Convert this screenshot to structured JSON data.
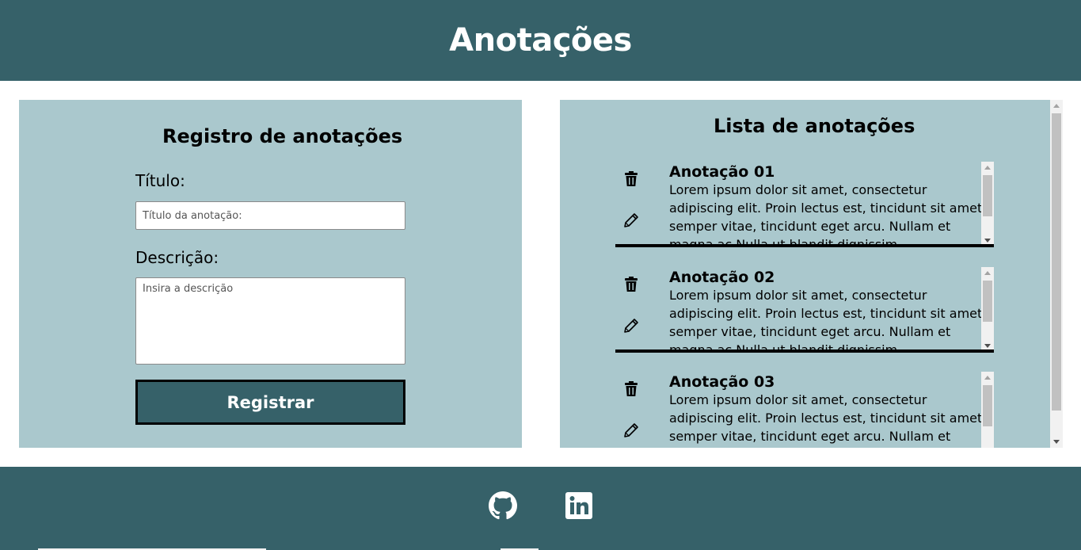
{
  "header": {
    "title": "Anotações"
  },
  "form": {
    "heading": "Registro de anotações",
    "title_label": "Título:",
    "title_placeholder": "Título da anotação:",
    "description_label": "Descrição:",
    "description_placeholder": "Insira a descrição",
    "submit_label": "Registrar"
  },
  "list": {
    "heading": "Lista de anotações",
    "notes": [
      {
        "title": "Anotação 01",
        "description": "Lorem ipsum dolor sit amet, consectetur adipiscing elit. Proin lectus est, tincidunt sit amet semper vitae, tincidunt eget arcu. Nullam et magna ac Nulla ut blandit dignissim."
      },
      {
        "title": "Anotação 02",
        "description": "Lorem ipsum dolor sit amet, consectetur adipiscing elit. Proin lectus est, tincidunt sit amet semper vitae, tincidunt eget arcu. Nullam et magna ac Nulla ut blandit dignissim."
      },
      {
        "title": "Anotação 03",
        "description": "Lorem ipsum dolor sit amet, consectetur adipiscing elit. Proin lectus est, tincidunt sit amet semper vitae, tincidunt eget arcu. Nullam et magna ac Nulla ut blandit dignissim."
      }
    ],
    "note_icons": {
      "delete": "trash-icon",
      "edit": "pencil-icon"
    }
  },
  "footer": {
    "links": [
      {
        "icon": "github-icon"
      },
      {
        "icon": "linkedin-icon"
      }
    ]
  },
  "colors": {
    "primary": "#366169",
    "panel": "#aac8cd",
    "background": "#ffffff",
    "text": "#000000"
  }
}
